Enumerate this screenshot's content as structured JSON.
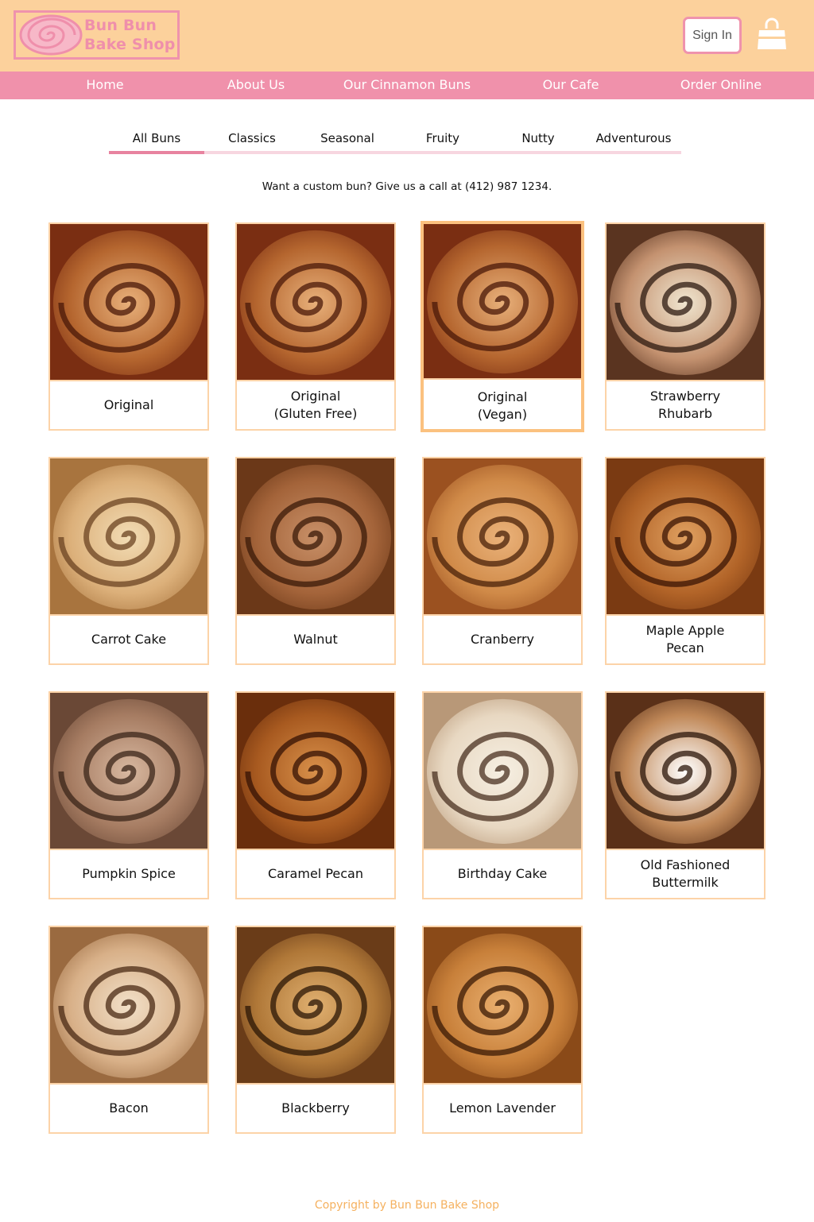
{
  "brand": {
    "line1": "Bun Bun",
    "line2": "Bake Shop"
  },
  "header": {
    "sign_in_label": "Sign In",
    "cart_icon": "shopping-bag-icon"
  },
  "nav": [
    {
      "label": "Home"
    },
    {
      "label": "About Us"
    },
    {
      "label": "Our Cinnamon Buns"
    },
    {
      "label": "Our Cafe"
    },
    {
      "label": "Order Online"
    }
  ],
  "filters": {
    "active": "All Buns",
    "items": [
      {
        "label": "All Buns"
      },
      {
        "label": "Classics"
      },
      {
        "label": "Seasonal"
      },
      {
        "label": "Fruity"
      },
      {
        "label": "Nutty"
      },
      {
        "label": "Adventurous"
      }
    ]
  },
  "callout": {
    "text": "Want a custom bun? Give us a call at  (412) 987 1234."
  },
  "products": [
    {
      "name": "Original",
      "selected": false
    },
    {
      "name": "Original\n(Gluten Free)",
      "selected": false
    },
    {
      "name": "Original\n(Vegan)",
      "selected": true
    },
    {
      "name": "Strawberry\nRhubarb",
      "selected": false
    },
    {
      "name": "Carrot Cake",
      "selected": false
    },
    {
      "name": "Walnut",
      "selected": false
    },
    {
      "name": "Cranberry",
      "selected": false
    },
    {
      "name": "Maple Apple\nPecan",
      "selected": false
    },
    {
      "name": "Pumpkin Spice",
      "selected": false
    },
    {
      "name": "Caramel Pecan",
      "selected": false
    },
    {
      "name": "Birthday Cake",
      "selected": false
    },
    {
      "name": "Old Fashioned\nButtermilk",
      "selected": false
    },
    {
      "name": "Bacon",
      "selected": false
    },
    {
      "name": "Blackberry",
      "selected": false
    },
    {
      "name": "Lemon Lavender",
      "selected": false
    }
  ],
  "footer": {
    "text": "Copyright by Bun Bun Bake Shop"
  },
  "colors": {
    "header_bg": "#fcd19c",
    "nav_bg": "#f091ab",
    "accent_pink": "#ef93ad",
    "card_border": "#fcd3a8",
    "selected_border": "#fbc17f",
    "footer_text": "#f5b15f"
  }
}
